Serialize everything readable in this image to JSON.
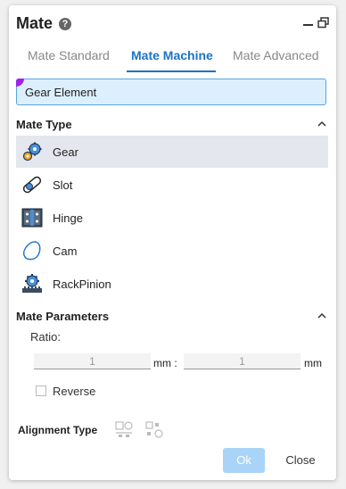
{
  "header": {
    "title": "Mate"
  },
  "tabs": [
    {
      "label": "Mate Standard"
    },
    {
      "label": "Mate Machine"
    },
    {
      "label": "Mate Advanced"
    }
  ],
  "selection": {
    "label": "Gear Element"
  },
  "mate_type": {
    "title": "Mate Type",
    "items": [
      {
        "label": "Gear",
        "icon": "gear-icon"
      },
      {
        "label": "Slot",
        "icon": "slot-icon"
      },
      {
        "label": "Hinge",
        "icon": "hinge-icon"
      },
      {
        "label": "Cam",
        "icon": "cam-icon"
      },
      {
        "label": "RackPinion",
        "icon": "rack-pinion-icon"
      }
    ]
  },
  "parameters": {
    "title": "Mate Parameters",
    "ratio_label": "Ratio:",
    "ratio_left": "1",
    "ratio_left_unit": "mm :",
    "ratio_right": "1",
    "ratio_right_unit": "mm",
    "reverse_label": "Reverse"
  },
  "alignment": {
    "label": "Alignment Type"
  },
  "buttons": {
    "ok": "Ok",
    "close": "Close"
  },
  "colors": {
    "accent": "#1a73c7",
    "selection_bg": "#dceffd",
    "ok_bg": "#a9d3f7"
  }
}
